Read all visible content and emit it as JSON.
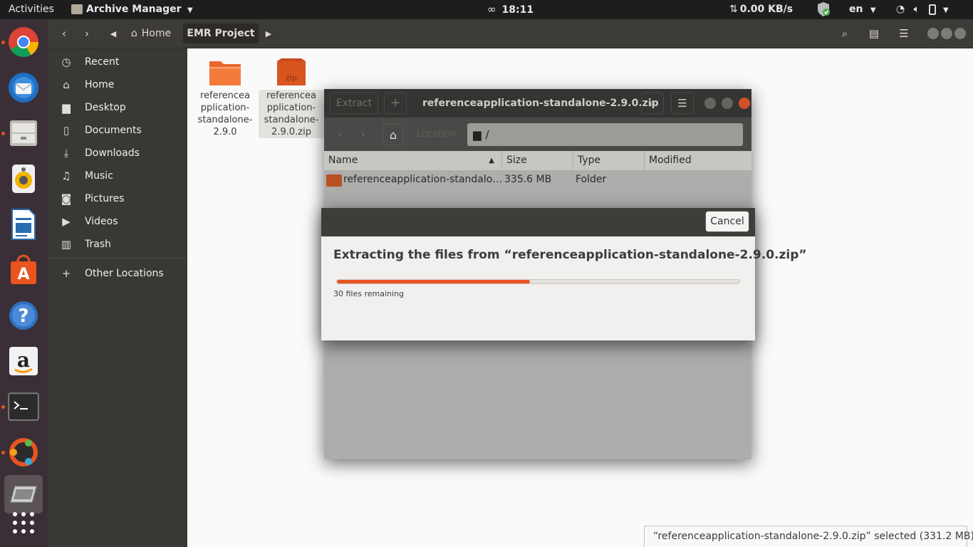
{
  "topbar": {
    "activities": "Activities",
    "app_name": "Archive Manager",
    "time": "18:11",
    "net_speed": "0.00 KB/s",
    "lang": "en"
  },
  "dock": {
    "items": [
      "chrome-icon",
      "thunderbird-icon",
      "files-icon",
      "rhythmbox-icon",
      "writer-icon",
      "software-icon",
      "help-icon",
      "amazon-icon",
      "terminal-icon",
      "ubuntu-icon",
      "archive-icon",
      "apps-grid-icon"
    ]
  },
  "nautilus": {
    "path": [
      "Home",
      "EMR Project"
    ],
    "sidebar": [
      {
        "label": "Recent",
        "icon": "clock-icon"
      },
      {
        "label": "Home",
        "icon": "home-icon"
      },
      {
        "label": "Desktop",
        "icon": "folder-icon"
      },
      {
        "label": "Documents",
        "icon": "document-icon"
      },
      {
        "label": "Downloads",
        "icon": "download-icon"
      },
      {
        "label": "Music",
        "icon": "music-icon"
      },
      {
        "label": "Pictures",
        "icon": "camera-icon"
      },
      {
        "label": "Videos",
        "icon": "video-icon"
      },
      {
        "label": "Trash",
        "icon": "trash-icon"
      },
      {
        "label": "Other Locations",
        "icon": "plus-icon"
      }
    ],
    "files": [
      {
        "name_lines": [
          "referencea",
          "pplication-",
          "standalone-",
          "2.9.0"
        ],
        "type": "folder"
      },
      {
        "name_lines": [
          "referencea",
          "pplication-",
          "standalone-",
          "2.9.0.zip"
        ],
        "type": "zip",
        "badge": "zip"
      }
    ]
  },
  "archive": {
    "extract_label": "Extract",
    "title": "referenceapplication-standalone-2.9.0.zip",
    "location_label": "Location:",
    "location_value": "/",
    "columns": [
      "Name",
      "Size",
      "Type",
      "Modified"
    ],
    "rows": [
      {
        "name": "referenceapplication-standalo…",
        "size": "335.6 MB",
        "type": "Folder",
        "modified": ""
      }
    ]
  },
  "dialog": {
    "cancel_label": "Cancel",
    "title": "Extracting the files from “referenceapplication-standalone-2.9.0.zip”",
    "status": "30 files remaining",
    "progress_fraction": 0.48
  },
  "status_overlay": "“referenceapplication-standalone-2.9.0.zip” selected  (331.2 MB)",
  "colors": {
    "accent": "#e95420",
    "topbar": "#1d1d1d",
    "dock": "#3a2f36",
    "headerbar": "#3c3b37"
  }
}
